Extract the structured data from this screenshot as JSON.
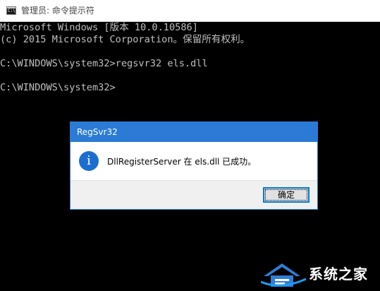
{
  "window": {
    "title": "管理员: 命令提示符",
    "icon": "cmd-icon",
    "icon_glyph": "C:\\."
  },
  "console": {
    "lines": [
      "Microsoft Windows [版本 10.0.10586]",
      "(c) 2015 Microsoft Corporation。保留所有权利。",
      "",
      "C:\\WINDOWS\\system32>regsvr32 els.dll",
      "",
      "C:\\WINDOWS\\system32>"
    ],
    "text_color": "#c0c0c0",
    "background": "#000000"
  },
  "dialog": {
    "title": "RegSvr32",
    "icon": "info-icon",
    "icon_glyph": "i",
    "message": "DllRegisterServer 在 els.dll 已成功。",
    "ok_label": "确定",
    "title_color": "#2b7bd6"
  },
  "watermark": {
    "text": "系统之家",
    "logo": "house-logo-icon"
  }
}
